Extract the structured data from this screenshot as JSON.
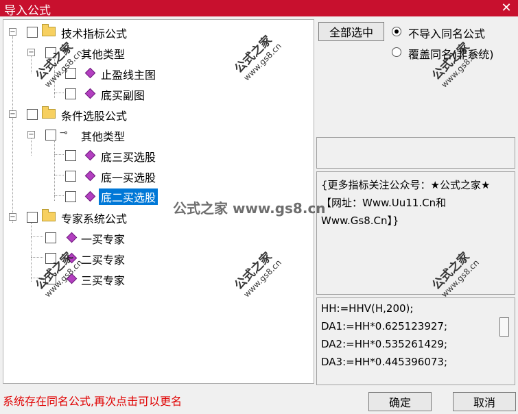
{
  "window": {
    "title": "导入公式",
    "close_glyph": "✕"
  },
  "tree": {
    "groups": [
      {
        "label": "技术指标公式",
        "sub": "其他类型",
        "items": [
          "止盈线主图",
          "底买副图"
        ]
      },
      {
        "label": "条件选股公式",
        "sub": "其他类型",
        "items": [
          "底三买选股",
          "底一买选股",
          "底二买选股"
        ]
      },
      {
        "label": "专家系统公式",
        "items": [
          "一买专家",
          "二买专家",
          "三买专家"
        ]
      }
    ],
    "selected": "底二买选股"
  },
  "controls": {
    "select_all": "全部选中",
    "radio_no_import": "不导入同名公式",
    "radio_overwrite": "覆盖同名(非系统)"
  },
  "description": "{更多指标关注公众号：★公式之家★【网址：Www.Uu11.Cn和Www.Gs8.Cn】}",
  "code_lines": [
    "HH:=HHV(H,200);",
    "DA1:=HH*0.625123927;",
    "DA2:=HH*0.535261429;",
    "DA3:=HH*0.445396073;"
  ],
  "status": "系统存在同名公式,再次点击可以更名",
  "buttons": {
    "ok": "确定",
    "cancel": "取消"
  },
  "watermark": {
    "center": "公式之家 www.gs8.cn",
    "stamp_title": "公式之家",
    "stamp_url": "www.gs8.cn"
  }
}
